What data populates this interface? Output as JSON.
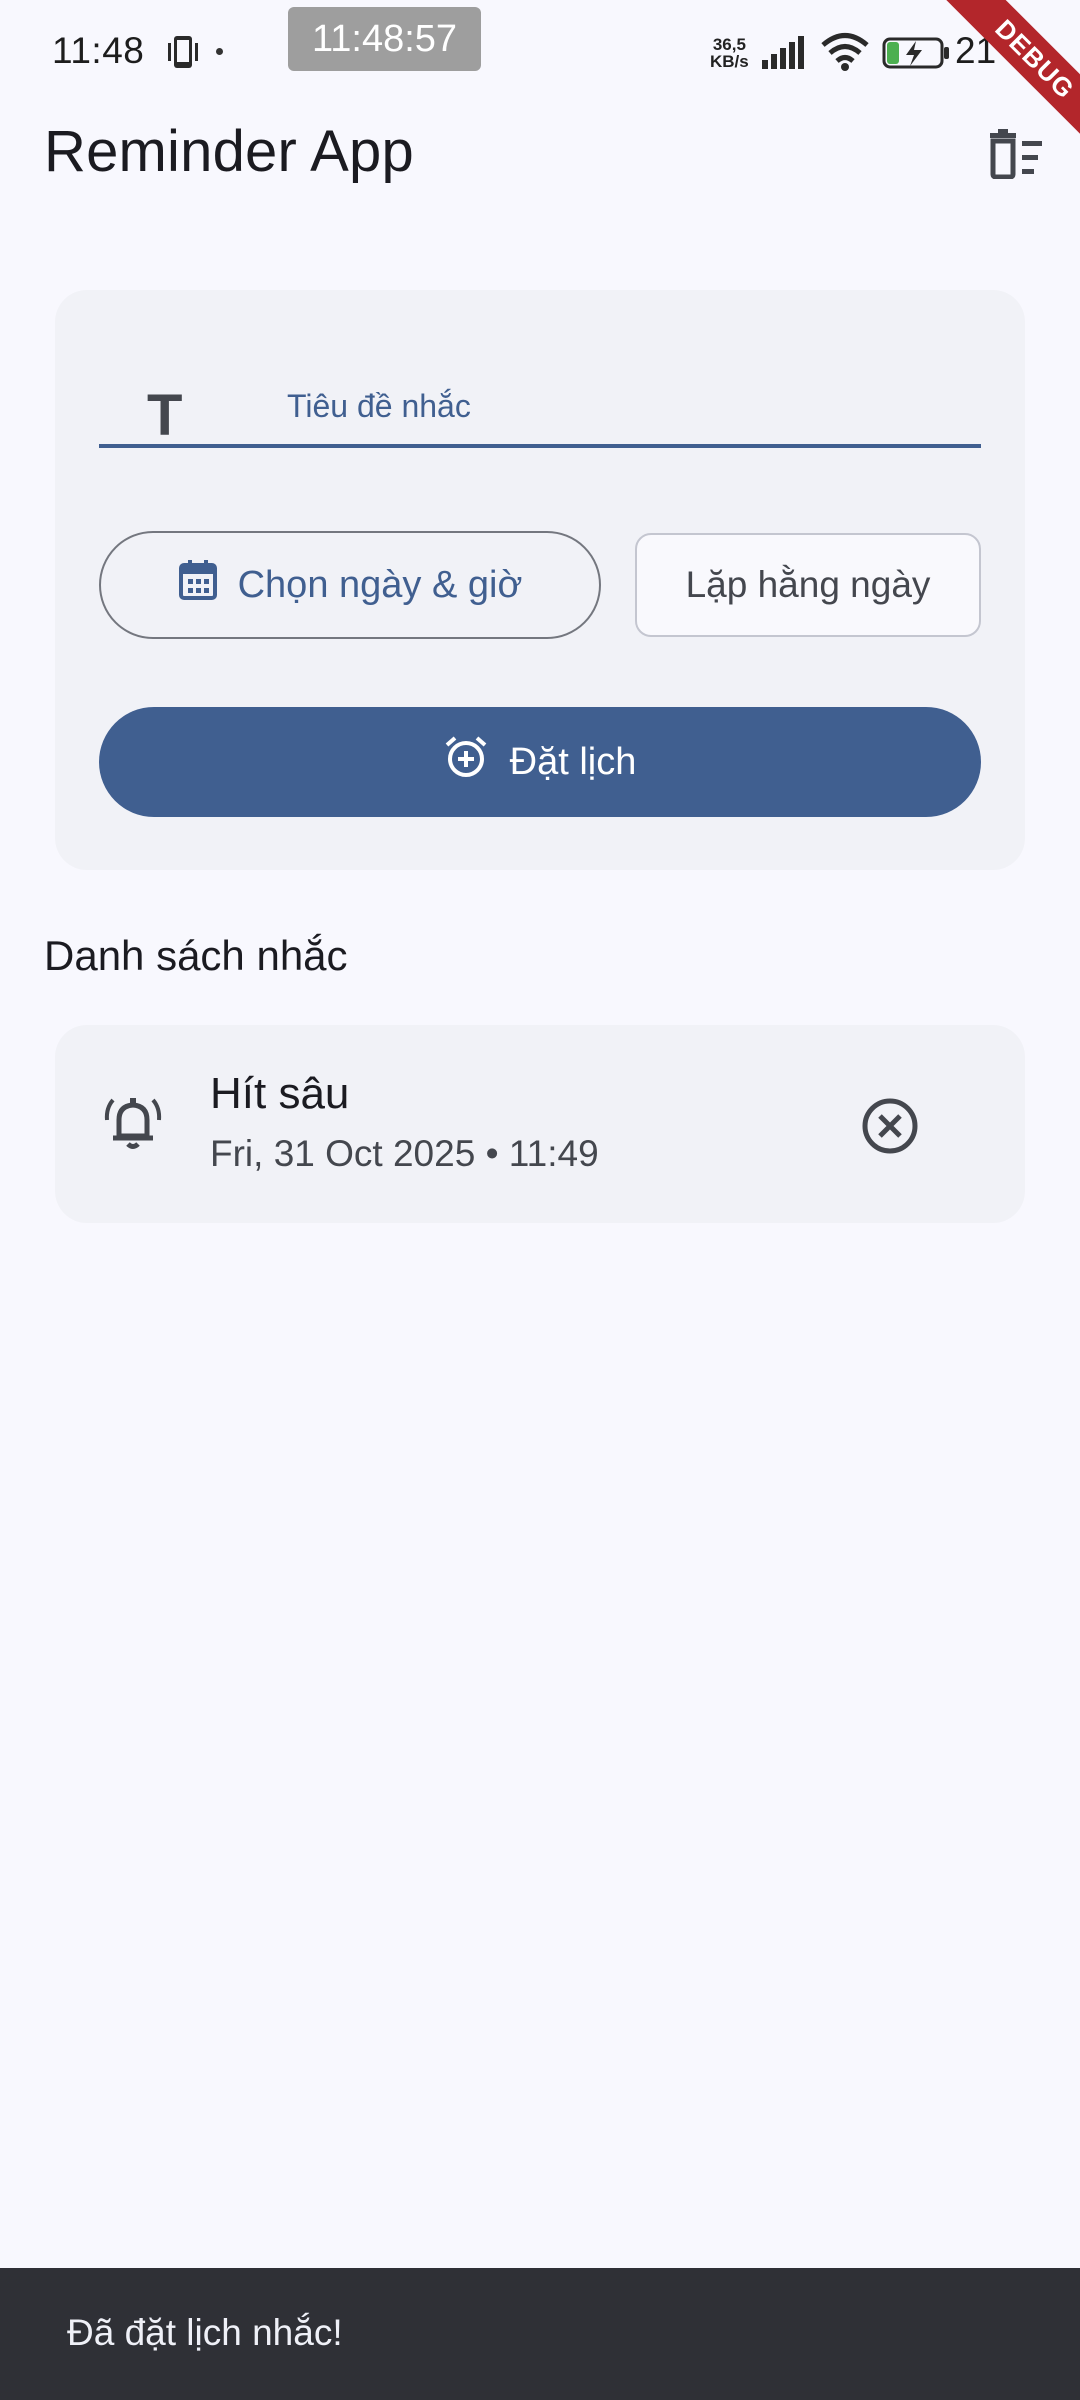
{
  "status_bar": {
    "time": "11:48",
    "chip_time": "11:48:57",
    "net_speed_value": "36,5",
    "net_speed_unit": "KB/s",
    "battery_percent": "21",
    "debug_label": "DEBUG"
  },
  "app_bar": {
    "title": "Reminder App",
    "delete_all_icon": "delete-sweep-icon"
  },
  "form": {
    "title_field": {
      "label": "Tiêu đề nhắc",
      "value": "",
      "icon": "title-icon",
      "icon_glyph": "T"
    },
    "pick_datetime_label": "Chọn ngày & giờ",
    "pick_datetime_icon": "calendar-icon",
    "repeat_daily_label": "Lặp hằng ngày",
    "schedule_label": "Đặt lịch",
    "schedule_icon": "alarm-add-icon"
  },
  "list": {
    "heading": "Danh sách nhắc",
    "items": [
      {
        "icon": "bell-ring-icon",
        "title": "Hít sâu",
        "subtitle": "Fri, 31 Oct 2025 • 11:49",
        "remove_icon": "cancel-circle-icon"
      }
    ]
  },
  "snackbar": {
    "message": "Đã đặt lịch nhắc!"
  },
  "colors": {
    "primary": "#405f90",
    "background": "#f8f8fe",
    "card": "#f1f2f7",
    "snackbar": "#2f3036",
    "debug": "#b3262b"
  }
}
